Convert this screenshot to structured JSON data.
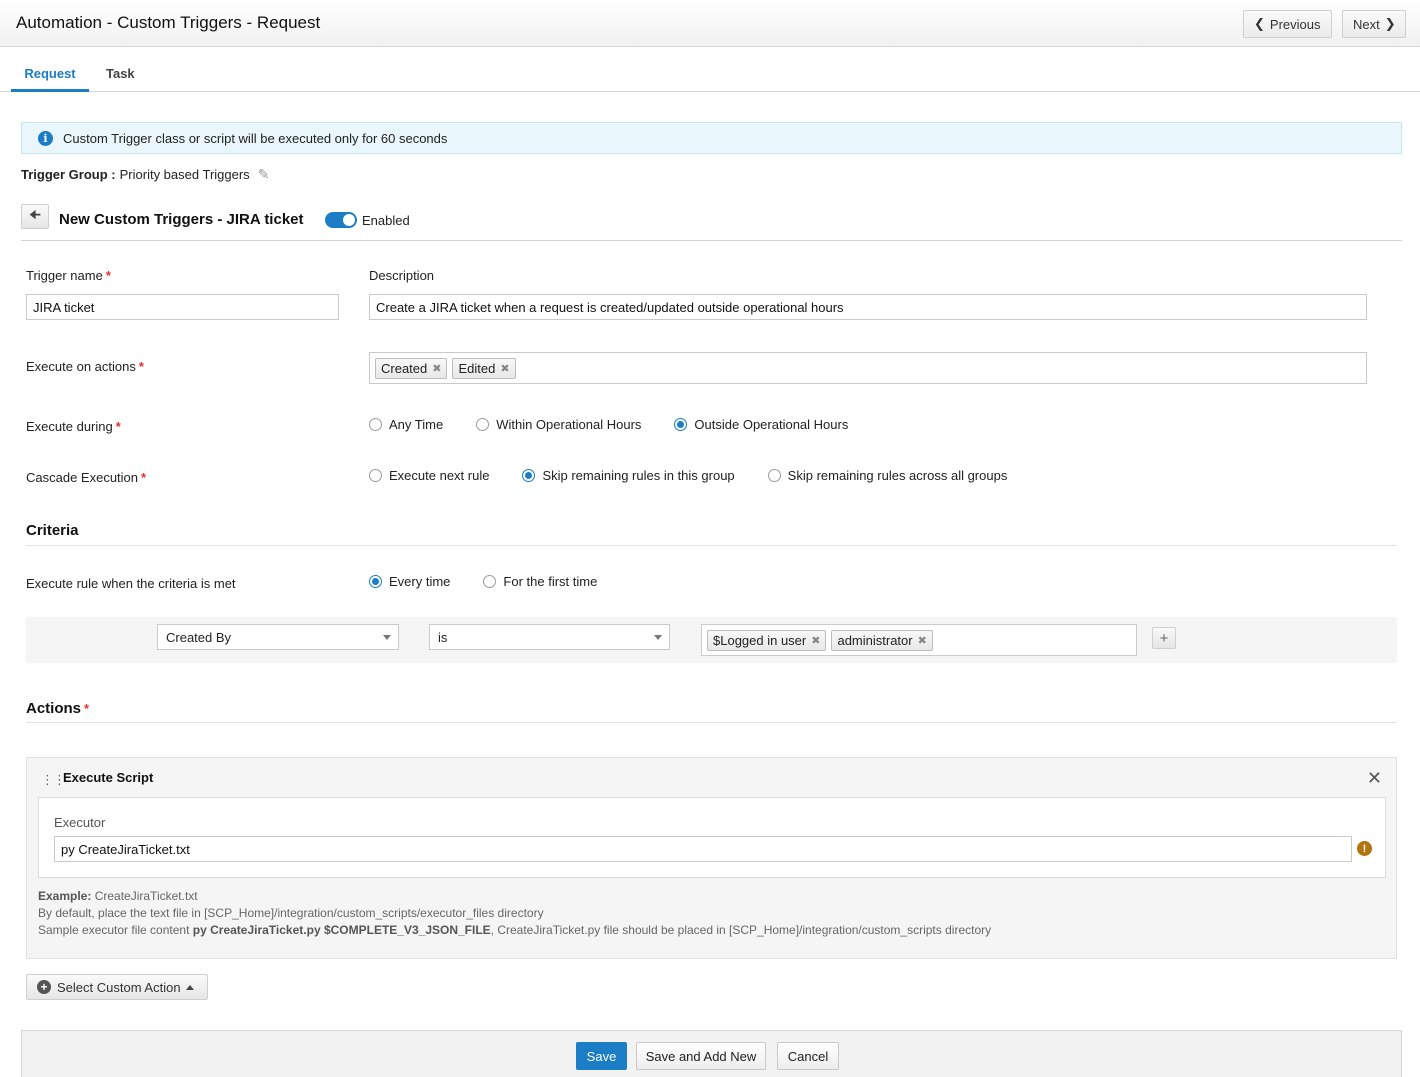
{
  "header": {
    "title": "Automation - Custom Triggers - Request",
    "previous_label": "Previous",
    "next_label": "Next"
  },
  "tabs": [
    {
      "label": "Request",
      "active": true
    },
    {
      "label": "Task",
      "active": false
    }
  ],
  "info_banner": {
    "text": "Custom Trigger class or script will be executed only for 60 seconds",
    "icon": "info-icon"
  },
  "trigger_group": {
    "label": "Trigger Group :",
    "value": "Priority based Triggers",
    "icon": "pencil-icon"
  },
  "trigger_header": {
    "title": "New Custom Triggers - JIRA ticket",
    "enabled_label": "Enabled",
    "enabled": true
  },
  "form": {
    "trigger_name_label": "Trigger name",
    "trigger_name_value": "JIRA ticket",
    "description_label": "Description",
    "description_value": "Create a JIRA ticket when a request is created/updated outside operational hours",
    "execute_on_actions_label": "Execute on actions",
    "execute_on_actions": [
      "Created",
      "Edited"
    ],
    "execute_during_label": "Execute during",
    "execute_during_options": [
      "Any Time",
      "Within Operational Hours",
      "Outside Operational Hours"
    ],
    "execute_during_selected": "Outside Operational Hours",
    "cascade_label": "Cascade Execution",
    "cascade_options": [
      "Execute next rule",
      "Skip remaining rules in this group",
      "Skip remaining rules across all groups"
    ],
    "cascade_selected": "Skip remaining rules in this group"
  },
  "criteria": {
    "heading": "Criteria",
    "execute_rule_label": "Execute rule when the criteria is met",
    "execute_rule_options": [
      "Every time",
      "For the first time"
    ],
    "execute_rule_selected": "Every time",
    "field_value": "Created By",
    "operator_value": "is",
    "values": [
      "$Logged in user",
      "administrator"
    ]
  },
  "actions": {
    "heading": "Actions",
    "action_title": "Execute Script",
    "executor_label": "Executor",
    "executor_value": "py CreateJiraTicket.txt",
    "example_label": "Example:",
    "example_value": "CreateJiraTicket.txt",
    "help_line2": "By default, place the text file in [SCP_Home]/integration/custom_scripts/executor_files directory",
    "help_line3_prefix": "Sample executor file content",
    "help_line3_bold": "py CreateJiraTicket.py $COMPLETE_V3_JSON_FILE",
    "help_line3_suffix": ", CreateJiraTicket.py file should be placed in [SCP_Home]/integration/custom_scripts directory",
    "select_custom_action_label": "Select Custom Action"
  },
  "footer": {
    "save_label": "Save",
    "save_add_label": "Save and Add New",
    "cancel_label": "Cancel"
  },
  "colors": {
    "accent": "#1a7dc6",
    "required": "#e0322c",
    "warning": "#b5730e",
    "info_bg": "#e9f6fb"
  }
}
